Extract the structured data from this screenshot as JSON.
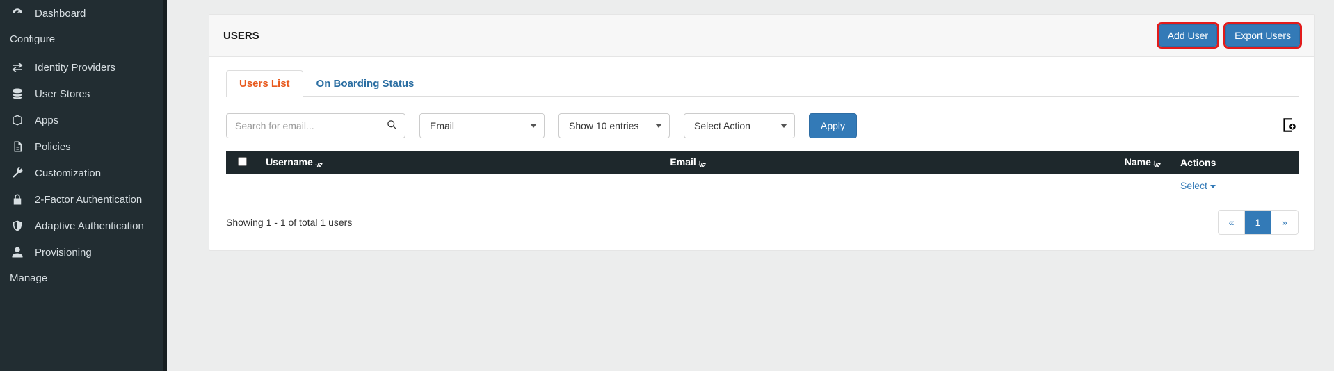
{
  "sidebar": {
    "items": [
      {
        "label": "Dashboard",
        "icon": "dashboard"
      }
    ],
    "configure_label": "Configure",
    "configure_items": [
      {
        "label": "Identity Providers",
        "icon": "swap"
      },
      {
        "label": "User Stores",
        "icon": "database"
      },
      {
        "label": "Apps",
        "icon": "box"
      },
      {
        "label": "Policies",
        "icon": "document"
      },
      {
        "label": "Customization",
        "icon": "wrench"
      },
      {
        "label": "2-Factor Authentication",
        "icon": "lock"
      },
      {
        "label": "Adaptive Authentication",
        "icon": "shield"
      },
      {
        "label": "Provisioning",
        "icon": "user"
      }
    ],
    "manage_label": "Manage"
  },
  "page": {
    "title": "USERS",
    "add_user_label": "Add User",
    "export_users_label": "Export Users"
  },
  "tabs": {
    "users_list": "Users List",
    "onboarding": "On Boarding Status"
  },
  "filters": {
    "search_placeholder": "Search for email...",
    "field_select": "Email",
    "entries_select": "Show 10 entries",
    "action_select": "Select Action",
    "apply_label": "Apply"
  },
  "table": {
    "headers": {
      "username": "Username",
      "email": "Email",
      "name": "Name",
      "actions": "Actions"
    },
    "rows": [
      {
        "username": "",
        "email": "",
        "name": "",
        "action_label": "Select"
      }
    ],
    "summary": "Showing 1 - 1 of total 1 users"
  },
  "pagination": {
    "prev": "«",
    "pages": [
      "1"
    ],
    "next": "»",
    "active": "1"
  }
}
